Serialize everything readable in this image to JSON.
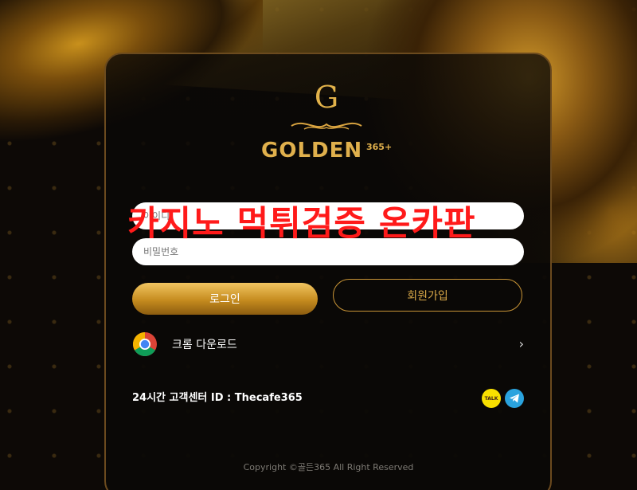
{
  "logo": {
    "letter": "G",
    "name": "GOLDEN",
    "suffix": "365+"
  },
  "overlay_text": "카지노 먹튀검증 온카판",
  "form": {
    "id_placeholder": "아이디",
    "pw_placeholder": "비밀번호",
    "login_label": "로그인",
    "join_label": "회원가입"
  },
  "chrome": {
    "label": "크롬 다운로드",
    "chevron": "›"
  },
  "support": {
    "text": "24시간 고객센터 ID : Thecafe365"
  },
  "icons": {
    "kakao_label": "TALK"
  },
  "footer": {
    "copyright": "Copyright ©골든365 All Right Reserved"
  },
  "colors": {
    "gold": "#e0b04c",
    "watermark": "#ff1a1a"
  }
}
